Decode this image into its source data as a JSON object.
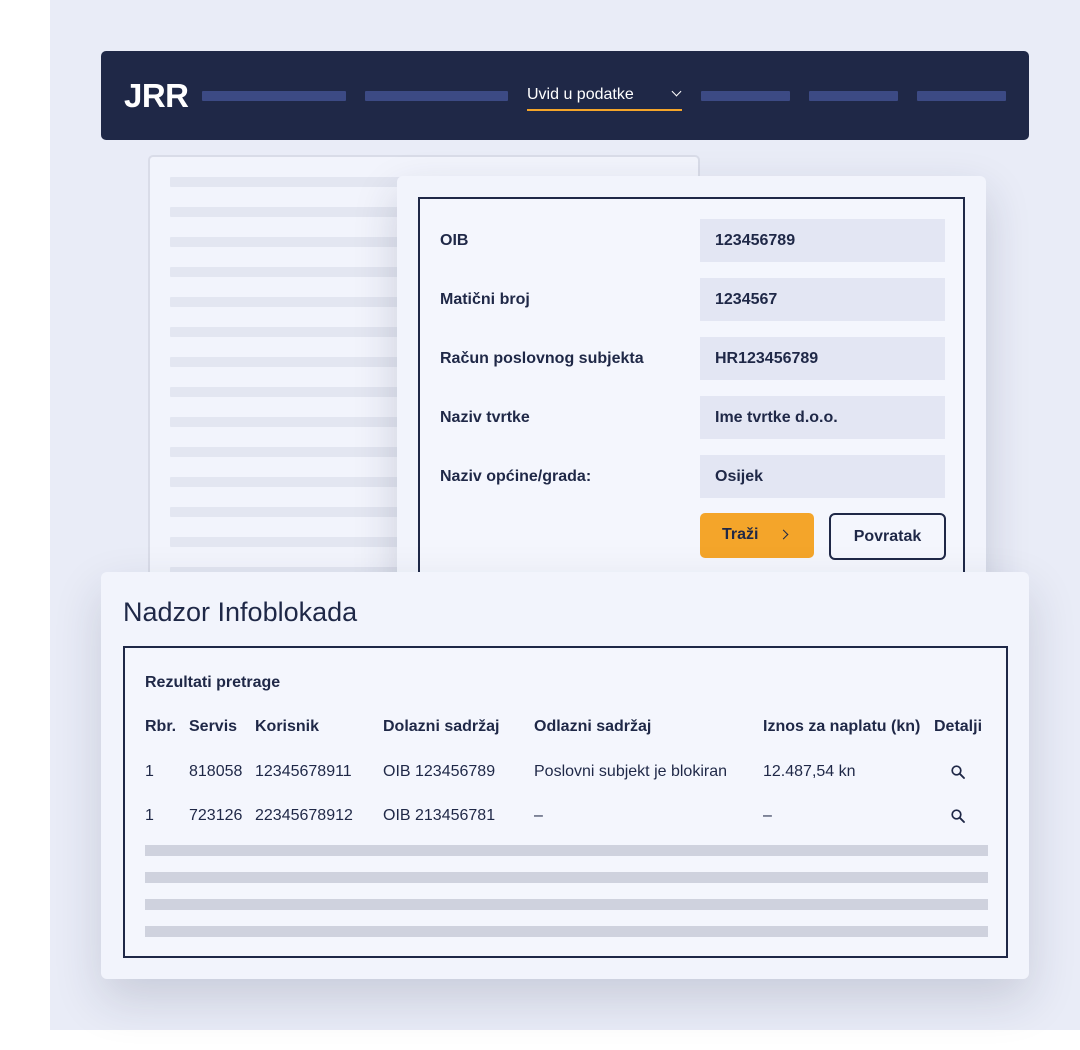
{
  "nav": {
    "logo": "JRR",
    "active_label": "Uvid u podatke",
    "accent_color": "#f4a52a"
  },
  "form": {
    "fields": [
      {
        "label": "OIB",
        "value": "123456789"
      },
      {
        "label": "Matični broj",
        "value": "1234567"
      },
      {
        "label": "Račun poslovnog subjekta",
        "value": "HR123456789"
      },
      {
        "label": "Naziv tvrtke",
        "value": "Ime tvrtke d.o.o."
      },
      {
        "label": "Naziv općine/grada:",
        "value": "Osijek"
      }
    ],
    "search_label": "Traži",
    "back_label": "Povratak"
  },
  "results": {
    "title": "Nadzor Infoblokada",
    "subtitle": "Rezultati pretrage",
    "columns": [
      "Rbr.",
      "Servis",
      "Korisnik",
      "Dolazni sadržaj",
      "Odlazni sadržaj",
      "Iznos za naplatu (kn)",
      "Detalji"
    ],
    "rows": [
      {
        "rbr": "1",
        "servis": "818058",
        "korisnik": "12345678911",
        "dolazni": "OIB 123456789",
        "odlazni": "Poslovni subjekt je blokiran",
        "iznos": "12.487,54 kn",
        "detalji_icon": "magnifier-icon"
      },
      {
        "rbr": "1",
        "servis": "723126",
        "korisnik": "22345678912",
        "dolazni": "OIB 213456781",
        "odlazni": "–",
        "iznos": "–",
        "detalji_icon": "magnifier-icon"
      }
    ]
  }
}
